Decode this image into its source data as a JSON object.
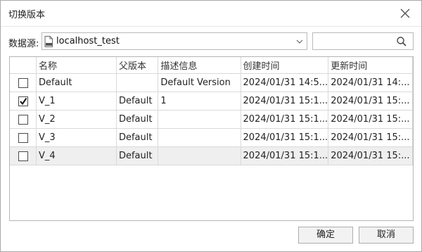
{
  "window": {
    "title": "切换版本"
  },
  "datasource": {
    "label": "数据源:",
    "value": "localhost_test",
    "icon": "pgis-database-icon"
  },
  "search": {
    "placeholder": ""
  },
  "table": {
    "columns": [
      "名称",
      "父版本",
      "描述信息",
      "创建时间",
      "更新时间"
    ],
    "rows": [
      {
        "checked": false,
        "cells": [
          "Default",
          "",
          "Default Version",
          "2024/01/31 14:5...",
          "2024/01/31 14:..."
        ]
      },
      {
        "checked": true,
        "cells": [
          "V_1",
          "Default",
          "1",
          "2024/01/31 15:1...",
          "2024/01/31 15:..."
        ]
      },
      {
        "checked": false,
        "cells": [
          "V_2",
          "Default",
          "",
          "2024/01/31 15:1...",
          "2024/01/31 15:..."
        ]
      },
      {
        "checked": false,
        "cells": [
          "V_3",
          "Default",
          "",
          "2024/01/31 15:1...",
          "2024/01/31 15:..."
        ]
      },
      {
        "checked": false,
        "cells": [
          "V_4",
          "Default",
          "",
          "2024/01/31 15:1...",
          "2024/01/31 15:..."
        ]
      }
    ]
  },
  "buttons": {
    "ok": "确定",
    "cancel": "取消"
  }
}
